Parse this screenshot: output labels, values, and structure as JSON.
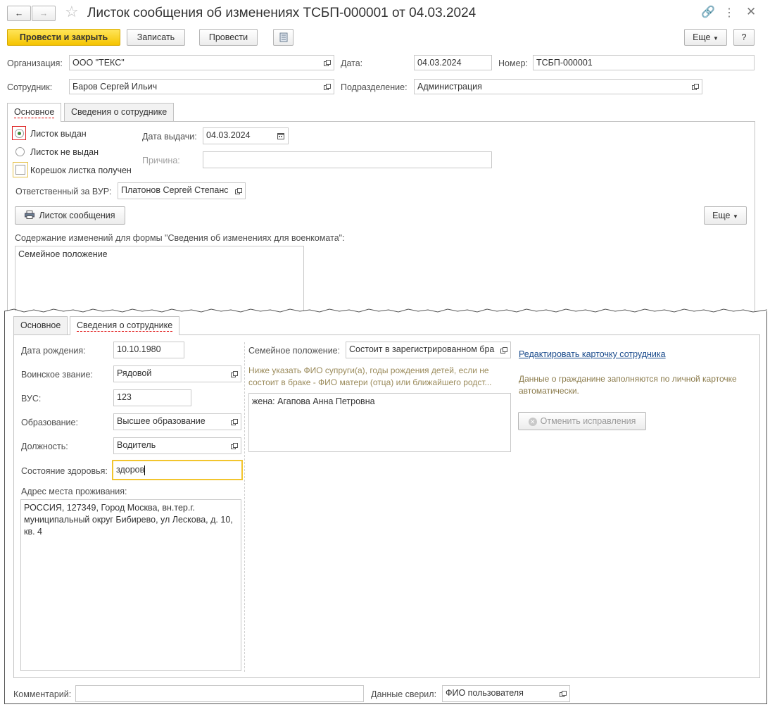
{
  "title": "Листок сообщения об изменениях ТСБП-000001 от 04.03.2024",
  "toolbar": {
    "post_close": "Провести и закрыть",
    "save": "Записать",
    "post": "Провести",
    "more": "Еще",
    "help": "?"
  },
  "header": {
    "org_label": "Организация:",
    "org_value": "ООО \"ТЕКС\"",
    "date_label": "Дата:",
    "date_value": "04.03.2024",
    "number_label": "Номер:",
    "number_value": "ТСБП-000001",
    "employee_label": "Сотрудник:",
    "employee_value": "Баров Сергей Ильич",
    "dept_label": "Подразделение:",
    "dept_value": "Администрация"
  },
  "tabs": [
    "Основное",
    "Сведения о сотруднике"
  ],
  "main": {
    "issued": "Листок выдан",
    "not_issued": "Листок не выдан",
    "stub": "Корешок листка получен",
    "issue_date_label": "Дата выдачи:",
    "issue_date_value": "04.03.2024",
    "reason_label": "Причина:",
    "reason_value": "",
    "responsible_label": "Ответственный за ВУР:",
    "responsible_value": "Платонов Сергей Степанс",
    "print_button": "Листок сообщения",
    "more": "Еще",
    "changes_label": "Содержание изменений для формы \"Сведения об изменениях для военкомата\":",
    "changes_value": "Семейное положение"
  },
  "employee": {
    "birth_label": "Дата рождения:",
    "birth_value": "10.10.1980",
    "rank_label": "Воинское звание:",
    "rank_value": "Рядовой",
    "vus_label": "ВУС:",
    "vus_value": "123",
    "education_label": "Образование:",
    "education_value": "Высшее образование",
    "position_label": "Должность:",
    "position_value": "Водитель",
    "health_label": "Состояние здоровья:",
    "health_value": "здоров",
    "address_label": "Адрес места проживания:",
    "address_value": "РОССИЯ, 127349, Город Москва, вн.тер.г. муниципальный округ Бибирево, ул Лескова, д. 10, кв. 4",
    "family_label": "Семейное положение:",
    "family_value": "Состоит в зарегистрированном бра",
    "family_hint": "Ниже указать ФИО супруги(а), годы рождения детей, если не состоит в браке - ФИО матери (отца) или ближайшего родст...",
    "family_text": "жена: Агапова Анна Петровна",
    "edit_link": "Редактировать карточку сотрудника",
    "auto_note": "Данные о гражданине заполняются по личной карточке автоматически.",
    "cancel_button": "Отменить исправления"
  },
  "footer": {
    "comment_label": "Комментарий:",
    "comment_value": "",
    "checked_label": "Данные сверил:",
    "checked_value": "ФИО пользователя"
  }
}
